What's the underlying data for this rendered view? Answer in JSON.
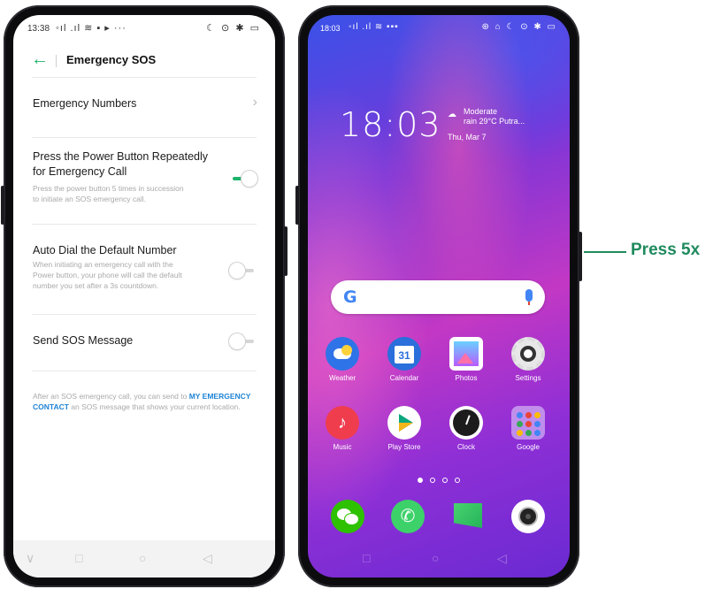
{
  "settings_screen": {
    "status": {
      "time": "13:38",
      "signal": "◦ıl .ıl ≋ ▪ ▸ ···",
      "right_icons": "☾ ⊙ ✱ ▭"
    },
    "title": "Emergency SOS",
    "items": [
      {
        "title": "Emergency Numbers"
      },
      {
        "title_line1": "Press the Power Button Repeatedly",
        "title_line2": "for Emergency Call",
        "desc_line1": "Press the power button 5 times in succession",
        "desc_line2": "to initiate an SOS emergency call.",
        "toggle": "on"
      },
      {
        "title": "Auto Dial the Default Number",
        "desc_line1": "When initiating an emergency call with the",
        "desc_line2": "Power button, your phone will call the default",
        "desc_line3": "number you set after a 3s countdown.",
        "toggle": "off"
      },
      {
        "title": "Send SOS Message",
        "toggle": "off"
      }
    ],
    "footer": {
      "part1": "After an SOS emergency call, you can send to ",
      "link": "MY EMERGENCY CONTACT",
      "part2": " an SOS message that shows your current location."
    },
    "nav": {
      "menu": "∨",
      "home_square": "□",
      "home": "○",
      "back": "◁"
    }
  },
  "home_screen": {
    "status": {
      "time": "18:03",
      "icons": "◦ıl .ıl ≋ ▪▪▪",
      "right_icons": "⊛ ⌂ ☾ ⊙ ✱ ▭"
    },
    "clock": "18:03",
    "weather_line1": "Moderate",
    "weather_line2": "rain 29°C  Putra...",
    "date": "Thu, Mar 7",
    "search_logo": "G",
    "apps_row1": [
      {
        "label": "Weather"
      },
      {
        "label": "Calendar",
        "glyph": "31"
      },
      {
        "label": "Photos"
      },
      {
        "label": "Settings"
      }
    ],
    "apps_row2": [
      {
        "label": "Music"
      },
      {
        "label": "Play Store"
      },
      {
        "label": "Clock"
      },
      {
        "label": "Google"
      }
    ],
    "dock_glyphs": {
      "phone": "✆"
    },
    "nav": {
      "home_square": "□",
      "home": "○",
      "back": "◁"
    }
  },
  "annotation": {
    "text": "Press 5x"
  },
  "colors": {
    "accent_green": "#1eb46c",
    "link_blue": "#1e84d6",
    "annotation_green": "#1f8a5e"
  },
  "icons": [
    "back-arrow-icon",
    "chevron-right-icon",
    "google-logo-icon",
    "mic-icon",
    "weather-app-icon",
    "calendar-app-icon",
    "photos-app-icon",
    "settings-app-icon",
    "music-app-icon",
    "play-store-app-icon",
    "clock-app-icon",
    "google-folder-icon",
    "wechat-app-icon",
    "phone-app-icon",
    "messages-app-icon",
    "camera-app-icon"
  ]
}
